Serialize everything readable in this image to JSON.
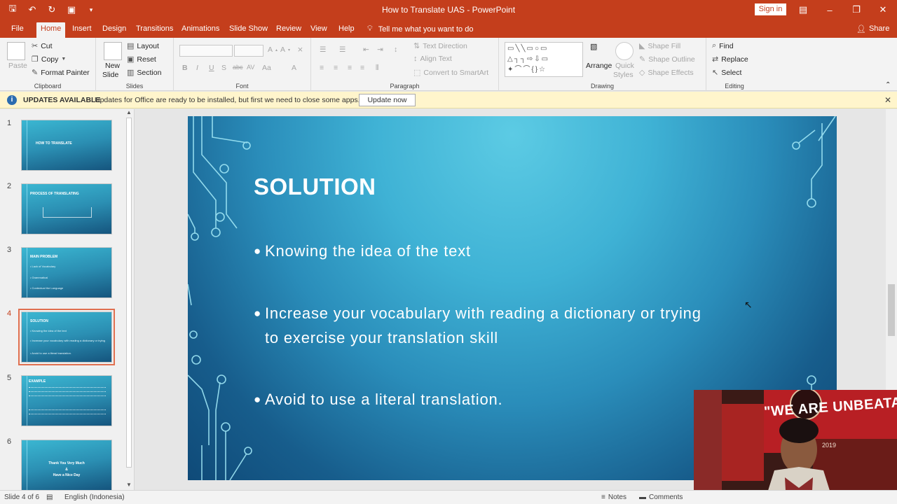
{
  "window": {
    "title": "How to Translate UAS - PowerPoint",
    "sign_in": "Sign in",
    "share": "Share",
    "tell_me": "Tell me what you want to do"
  },
  "tabs": [
    "File",
    "Home",
    "Insert",
    "Design",
    "Transitions",
    "Animations",
    "Slide Show",
    "Review",
    "View",
    "Help"
  ],
  "ribbon": {
    "clipboard": {
      "label": "Clipboard",
      "paste": "Paste",
      "cut": "Cut",
      "copy": "Copy",
      "format_painter": "Format Painter"
    },
    "slides": {
      "label": "Slides",
      "new_slide": "New",
      "new_slide_2": "Slide",
      "layout": "Layout",
      "reset": "Reset",
      "section": "Section"
    },
    "font": {
      "label": "Font"
    },
    "paragraph": {
      "label": "Paragraph",
      "text_direction": "Text Direction",
      "align_text": "Align Text",
      "convert_smartart": "Convert to SmartArt"
    },
    "drawing": {
      "label": "Drawing",
      "arrange": "Arrange",
      "quick_styles": "Quick",
      "quick_styles_2": "Styles",
      "shape_fill": "Shape Fill",
      "shape_outline": "Shape Outline",
      "shape_effects": "Shape Effects"
    },
    "editing": {
      "label": "Editing",
      "find": "Find",
      "replace": "Replace",
      "select": "Select"
    }
  },
  "update_bar": {
    "title": "UPDATES AVAILABLE",
    "message": "Updates for Office are ready to be installed, but first we need to close some apps.",
    "button": "Update now"
  },
  "thumbnails": [
    {
      "num": "1",
      "title": "HOW TO TRANSLATE",
      "lines": []
    },
    {
      "num": "2",
      "title": "PROCESS OF TRANSLATING",
      "lines": []
    },
    {
      "num": "3",
      "title": "MAIN PROBLEM",
      "lines": [
        "• Lack of Vocabulary",
        "• Grammatical",
        "• Contextual the Language"
      ]
    },
    {
      "num": "4",
      "title": "SOLUTION",
      "lines": [
        "• Knowing the idea of the text",
        "• Increase your vocabulary with reading a dictionary or trying",
        "• Avoid to use a literal translation."
      ]
    },
    {
      "num": "5",
      "title": "EXAMPLE",
      "lines": []
    },
    {
      "num": "6",
      "title": "Thank You Very Much",
      "lines": [
        "&",
        "Have a Nice Day"
      ]
    }
  ],
  "slide": {
    "title": "SOLUTION",
    "bullets": [
      {
        "line1": "Knowing the idea of the text",
        "line2": ""
      },
      {
        "line1": "Increase your vocabulary with reading a dictionary or trying",
        "line2": "to exercise your translation skill"
      },
      {
        "line1": "Avoid to use a literal translation.",
        "line2": ""
      }
    ]
  },
  "webcam": {
    "banner": "\"WE ARE UNBEATABLE\"",
    "year": "2019"
  },
  "status": {
    "slide_count": "Slide 4 of 6",
    "language": "English (Indonesia)",
    "notes": "Notes",
    "comments": "Comments"
  },
  "colors": {
    "brand": "#c43e1c",
    "ribbon_bg": "#f3f3f3",
    "update_bg": "#fff5cc"
  }
}
